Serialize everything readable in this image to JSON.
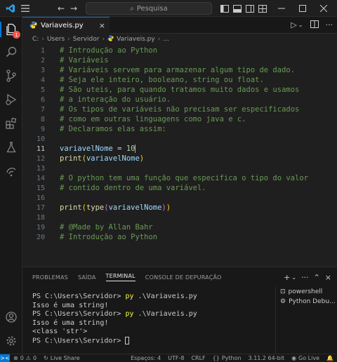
{
  "titlebar": {
    "search_placeholder": "Pesquisa",
    "back_icon": "arrow-left-icon",
    "forward_icon": "arrow-right-icon"
  },
  "activity_bar": {
    "explorer_badge": "1"
  },
  "tab": {
    "filename": "Variaveis.py",
    "close": "×"
  },
  "breadcrumb": [
    "C:",
    "Users",
    "Servidor",
    "Variaveis.py",
    "..."
  ],
  "editor": {
    "lines": [
      {
        "n": "1",
        "tokens": [
          {
            "t": "# Introdução ao Python",
            "c": "c-comment"
          }
        ]
      },
      {
        "n": "2",
        "tokens": [
          {
            "t": "# Variáveis",
            "c": "c-comment"
          }
        ]
      },
      {
        "n": "3",
        "tokens": [
          {
            "t": "# Variáveis servem para armazenar algum tipo de dado.",
            "c": "c-comment"
          }
        ]
      },
      {
        "n": "4",
        "tokens": [
          {
            "t": "# Seja ele inteiro, booleano, string ou float.",
            "c": "c-comment"
          }
        ]
      },
      {
        "n": "5",
        "tokens": [
          {
            "t": "# São uteis, para quando tratamos muito dados e usamos",
            "c": "c-comment"
          }
        ]
      },
      {
        "n": "6",
        "tokens": [
          {
            "t": "# a interação do usuário.",
            "c": "c-comment"
          }
        ]
      },
      {
        "n": "7",
        "tokens": [
          {
            "t": "# Os tipos de variáveis não precisam ser especificados",
            "c": "c-comment"
          }
        ]
      },
      {
        "n": "8",
        "tokens": [
          {
            "t": "# como em outras linguagens como java e c.",
            "c": "c-comment"
          }
        ]
      },
      {
        "n": "9",
        "tokens": [
          {
            "t": "# Declaramos elas assim:",
            "c": "c-comment"
          }
        ]
      },
      {
        "n": "10",
        "tokens": []
      },
      {
        "n": "11",
        "tokens": [
          {
            "t": "variavelNome",
            "c": "c-var"
          },
          {
            "t": " = ",
            "c": "c-op"
          },
          {
            "t": "10",
            "c": "c-num"
          }
        ],
        "current": true
      },
      {
        "n": "12",
        "tokens": [
          {
            "t": "print",
            "c": "c-fn"
          },
          {
            "t": "(",
            "c": "c-paren1"
          },
          {
            "t": "variavelNome",
            "c": "c-var"
          },
          {
            "t": ")",
            "c": "c-paren1"
          }
        ]
      },
      {
        "n": "13",
        "tokens": []
      },
      {
        "n": "14",
        "tokens": [
          {
            "t": "# O python tem uma função que especifica o tipo do valor",
            "c": "c-comment"
          }
        ]
      },
      {
        "n": "15",
        "tokens": [
          {
            "t": "# contido dentro de uma variável.",
            "c": "c-comment"
          }
        ]
      },
      {
        "n": "16",
        "tokens": []
      },
      {
        "n": "17",
        "tokens": [
          {
            "t": "print",
            "c": "c-fn"
          },
          {
            "t": "(",
            "c": "c-paren1"
          },
          {
            "t": "type",
            "c": "c-fn"
          },
          {
            "t": "(",
            "c": "c-paren2"
          },
          {
            "t": "variavelNome",
            "c": "c-var"
          },
          {
            "t": ")",
            "c": "c-paren2"
          },
          {
            "t": ")",
            "c": "c-paren1"
          }
        ]
      },
      {
        "n": "18",
        "tokens": []
      },
      {
        "n": "19",
        "tokens": [
          {
            "t": "# @Made by Allan Bahr",
            "c": "c-comment"
          }
        ]
      },
      {
        "n": "20",
        "tokens": [
          {
            "t": "# Introdução ao Python",
            "c": "c-comment"
          }
        ]
      }
    ]
  },
  "panel": {
    "tabs": [
      {
        "label": "PROBLEMAS",
        "active": false
      },
      {
        "label": "SAÍDA",
        "active": false
      },
      {
        "label": "TERMINAL",
        "active": true
      },
      {
        "label": "CONSOLE DE DEPURAÇÃO",
        "active": false
      }
    ],
    "terminal_lines": [
      {
        "prompt": "PS C:\\Users\\Servidor> ",
        "cmd": "py",
        "rest": " .\\Variaveis.py"
      },
      {
        "text": "Isso é uma string!"
      },
      {
        "prompt": "PS C:\\Users\\Servidor> ",
        "cmd": "py",
        "rest": " .\\Variaveis.py"
      },
      {
        "text": "Isso é uma string!"
      },
      {
        "text": "<class 'str'>"
      },
      {
        "prompt": "PS C:\\Users\\Servidor> ",
        "cursor": true
      }
    ],
    "terminal_list": [
      "powershell",
      "Python Debu..."
    ]
  },
  "statusbar": {
    "left": [
      {
        "icon": "error-icon",
        "text": "0"
      },
      {
        "icon": "warning-icon",
        "text": "0"
      },
      {
        "icon": "live-share-icon",
        "text": "Live Share"
      }
    ],
    "right": [
      {
        "text": "Espaços: 4"
      },
      {
        "text": "UTF-8"
      },
      {
        "text": "CRLF"
      },
      {
        "text": "Python",
        "icon": "braces-icon"
      },
      {
        "text": "3.11.2 64-bit"
      },
      {
        "text": "Go Live",
        "icon": "broadcast-icon"
      }
    ]
  },
  "colors": {
    "accent": "#0078d4",
    "comment": "#6a9955",
    "variable": "#9cdcfe",
    "function": "#dcdcaa",
    "number": "#b5cea8"
  }
}
